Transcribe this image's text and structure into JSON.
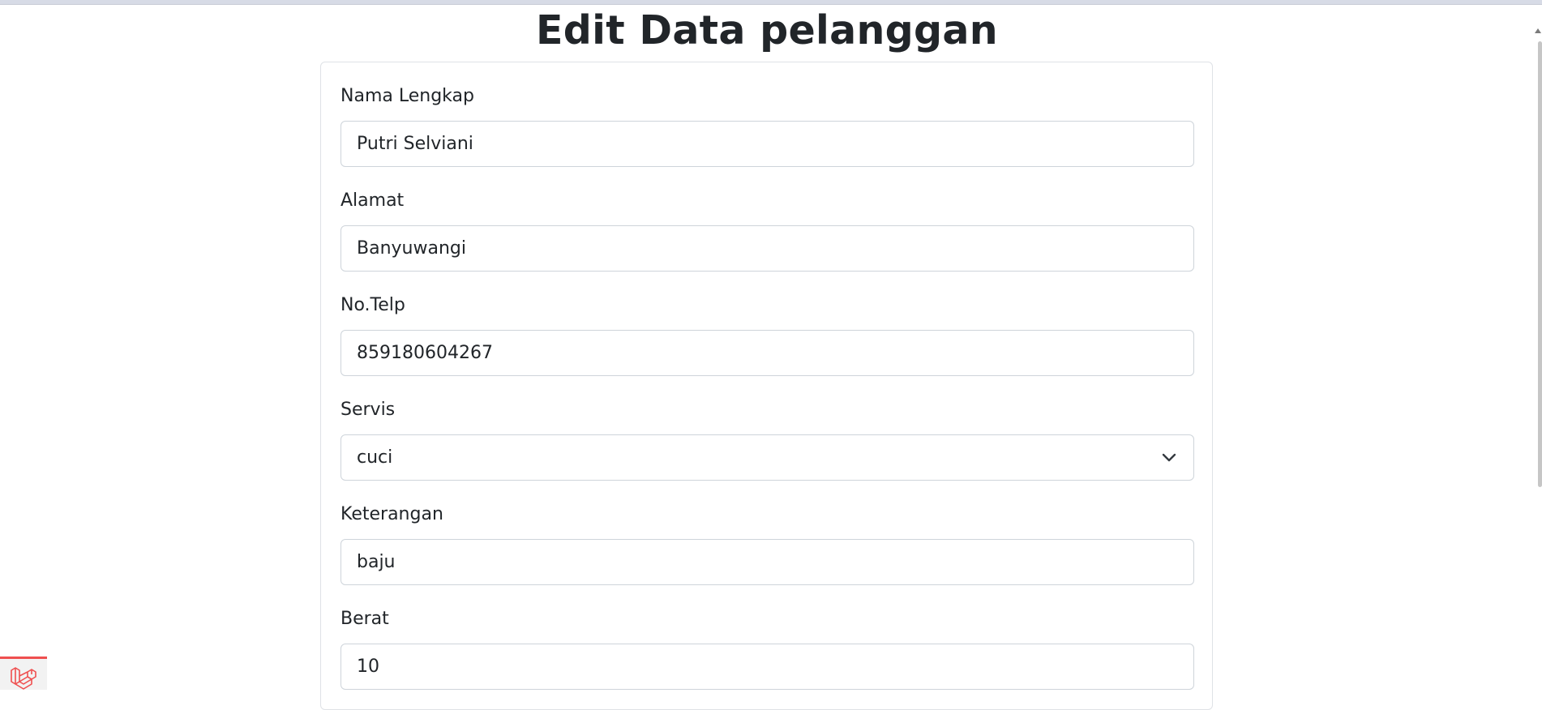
{
  "page": {
    "title": "Edit Data pelanggan"
  },
  "form": {
    "nama": {
      "label": "Nama Lengkap",
      "value": "Putri Selviani"
    },
    "alamat": {
      "label": "Alamat",
      "value": "Banyuwangi"
    },
    "telp": {
      "label": "No.Telp",
      "value": "859180604267"
    },
    "servis": {
      "label": "Servis",
      "selected": "cuci"
    },
    "keterangan": {
      "label": "Keterangan",
      "value": "baju"
    },
    "berat": {
      "label": "Berat",
      "value": "10"
    }
  },
  "icons": {
    "select_chevron": "chevron-down-icon",
    "debug_badge": "laravel-logo-icon"
  },
  "colors": {
    "text": "#212529",
    "border": "#ced4da",
    "badge_accent": "#ef4f4f"
  }
}
